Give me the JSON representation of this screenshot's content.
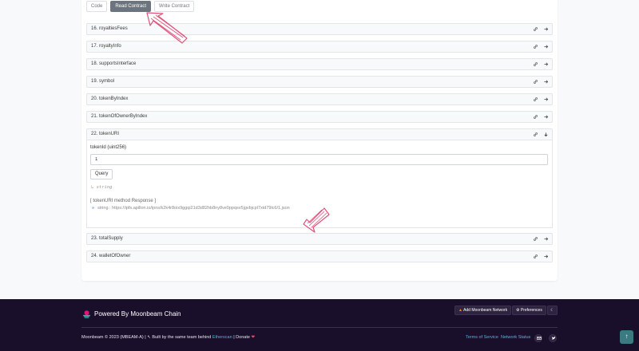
{
  "tabs": [
    {
      "label": "Code",
      "active": false
    },
    {
      "label": "Read Contract",
      "active": true
    },
    {
      "label": "Write Contract",
      "active": false
    }
  ],
  "methods": [
    {
      "label": "16. royaltiesFees",
      "expanded": false
    },
    {
      "label": "17. royaltyInfo",
      "expanded": false
    },
    {
      "label": "18. supportsInterface",
      "expanded": false
    },
    {
      "label": "19. symbol",
      "expanded": false
    },
    {
      "label": "20. tokenByIndex",
      "expanded": false
    },
    {
      "label": "21. tokenOfOwnerByIndex",
      "expanded": false
    },
    {
      "label": "22. tokenURI",
      "expanded": true
    },
    {
      "label": "23. totalSupply",
      "expanded": false
    },
    {
      "label": "24. walletOfOwner",
      "expanded": false
    }
  ],
  "token_uri": {
    "param_label": "tokenId (uint256)",
    "param_value": "1",
    "query_label": "Query",
    "return_type": "string",
    "response_title": "[ tokenURI method Response ]",
    "response_value": "string :  https://ipfs.apillon.io/ipns/k2k4r8oix9ggqi21d3d82hb8ny8ve0ppqsv5jgvbjcpl7xtd79lc6/1.json"
  },
  "footer": {
    "powered_by": "Powered By Moonbeam Chain",
    "add_network": "Add Moonbeam Network",
    "preferences": "Preferences",
    "copyright": "Moonbeam © 2023 (MBEAM-A)",
    "built_by": "Built by the same team behind",
    "etherscan": "Etherscan",
    "donate": "Donate",
    "terms": "Terms of Service",
    "network_status": "Network Status",
    "scroll_top": "↑"
  },
  "colors": {
    "footer_bg": "#1a0f2b",
    "active_tab": "#6c757d",
    "link": "#5bb0d6",
    "annotation": "#e0527a"
  }
}
